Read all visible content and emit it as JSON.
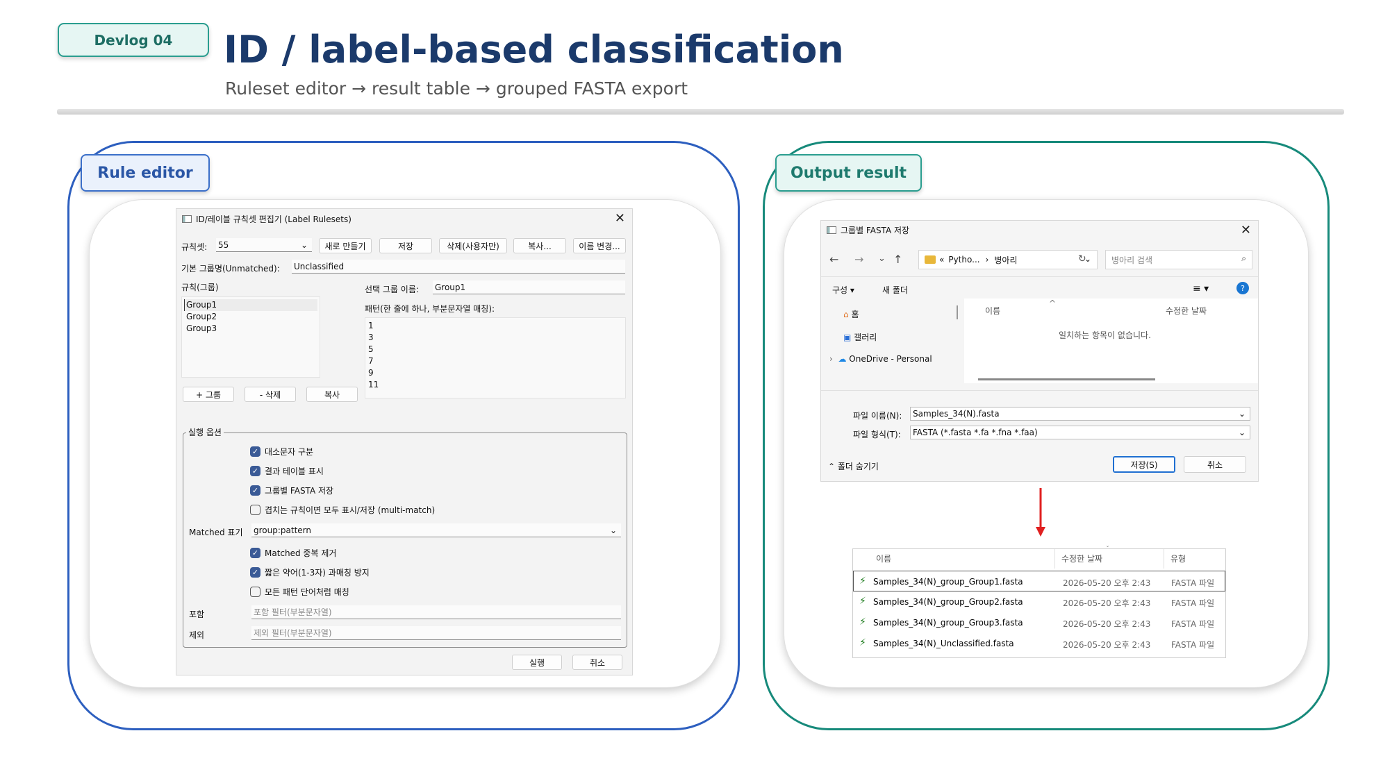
{
  "header": {
    "badge": "Devlog 04",
    "title": "ID / label-based classification",
    "subtitle": "Ruleset editor → result table → grouped FASTA export"
  },
  "left_panel": {
    "tag": "Rule editor",
    "dialog": {
      "title": "ID/레이블 규칙셋 편집기 (Label Rulesets)",
      "ruleset_label": "규칙셋:",
      "ruleset_value": "55",
      "buttons_top": [
        "새로 만들기",
        "저장",
        "삭제(사용자만)",
        "복사...",
        "이름 변경..."
      ],
      "default_group_label": "기본 그룹명(Unmatched):",
      "default_group_value": "Unclassified",
      "rules_label": "규칙(그룹)",
      "groups": [
        "Group1",
        "Group2",
        "Group3"
      ],
      "selected_group_label": "선택 그룹 이름:",
      "selected_group_value": "Group1",
      "pattern_label": "패턴(한 줄에 하나, 부분문자열 매칭):",
      "patterns": [
        "1",
        "3",
        "5",
        "7",
        "9",
        "11"
      ],
      "group_buttons": [
        "+ 그룹",
        "- 삭제",
        "복사"
      ],
      "run_options_label": "실행 옵션",
      "options_a": [
        {
          "label": "대소문자 구분",
          "checked": true
        },
        {
          "label": "결과 테이블 표시",
          "checked": true
        },
        {
          "label": "그룹별 FASTA 저장",
          "checked": true
        },
        {
          "label": "겹치는 규칙이면 모두 표시/저장 (multi-match)",
          "checked": false
        }
      ],
      "matched_display_label": "Matched 표기",
      "matched_display_value": "group:pattern",
      "options_b": [
        {
          "label": "Matched 중복 제거",
          "checked": true
        },
        {
          "label": "짧은 약어(1-3자) 과매칭 방지",
          "checked": true
        },
        {
          "label": "모든 패턴 단어처럼 매칭",
          "checked": false
        }
      ],
      "include_label": "포함",
      "include_placeholder": "포함 필터(부분문자열)",
      "exclude_label": "제외",
      "exclude_placeholder": "제외 필터(부분문자열)",
      "run_button": "실행",
      "cancel_button": "취소"
    }
  },
  "right_panel": {
    "tag": "Output result",
    "save_dialog": {
      "title": "그룹별 FASTA 저장",
      "path_prefix": "«",
      "path_parts": [
        "Pytho...",
        "병아리"
      ],
      "search_placeholder": "병아리 검색",
      "organize": "구성",
      "new_folder": "새 폴더",
      "nav_items": [
        "홈",
        "갤러리",
        "OneDrive - Personal"
      ],
      "col_name": "이름",
      "col_modified": "수정한 날짜",
      "empty_message": "일치하는 항목이 없습니다.",
      "filename_label": "파일 이름(N):",
      "filename_value": "Samples_34(N).fasta",
      "filetype_label": "파일 형식(T):",
      "filetype_value": "FASTA (*.fasta *.fa *.fna *.faa)",
      "hide_folders": "폴더 숨기기",
      "save_button": "저장(S)",
      "cancel_button": "취소"
    },
    "file_list": {
      "columns": [
        "이름",
        "수정한 날짜",
        "유형"
      ],
      "rows": [
        {
          "name": "Samples_34(N)_group_Group1.fasta",
          "modified": "2026-05-20 오후 2:43",
          "type": "FASTA 파일"
        },
        {
          "name": "Samples_34(N)_group_Group2.fasta",
          "modified": "2026-05-20 오후 2:43",
          "type": "FASTA 파일"
        },
        {
          "name": "Samples_34(N)_group_Group3.fasta",
          "modified": "2026-05-20 오후 2:43",
          "type": "FASTA 파일"
        },
        {
          "name": "Samples_34(N)_Unclassified.fasta",
          "modified": "2026-05-20 오후 2:43",
          "type": "FASTA 파일"
        }
      ]
    }
  },
  "colors": {
    "navy": "#1b3a6b",
    "blue_border": "#2d5fbf",
    "teal_border": "#178a7b",
    "arrow": "#e02020"
  }
}
